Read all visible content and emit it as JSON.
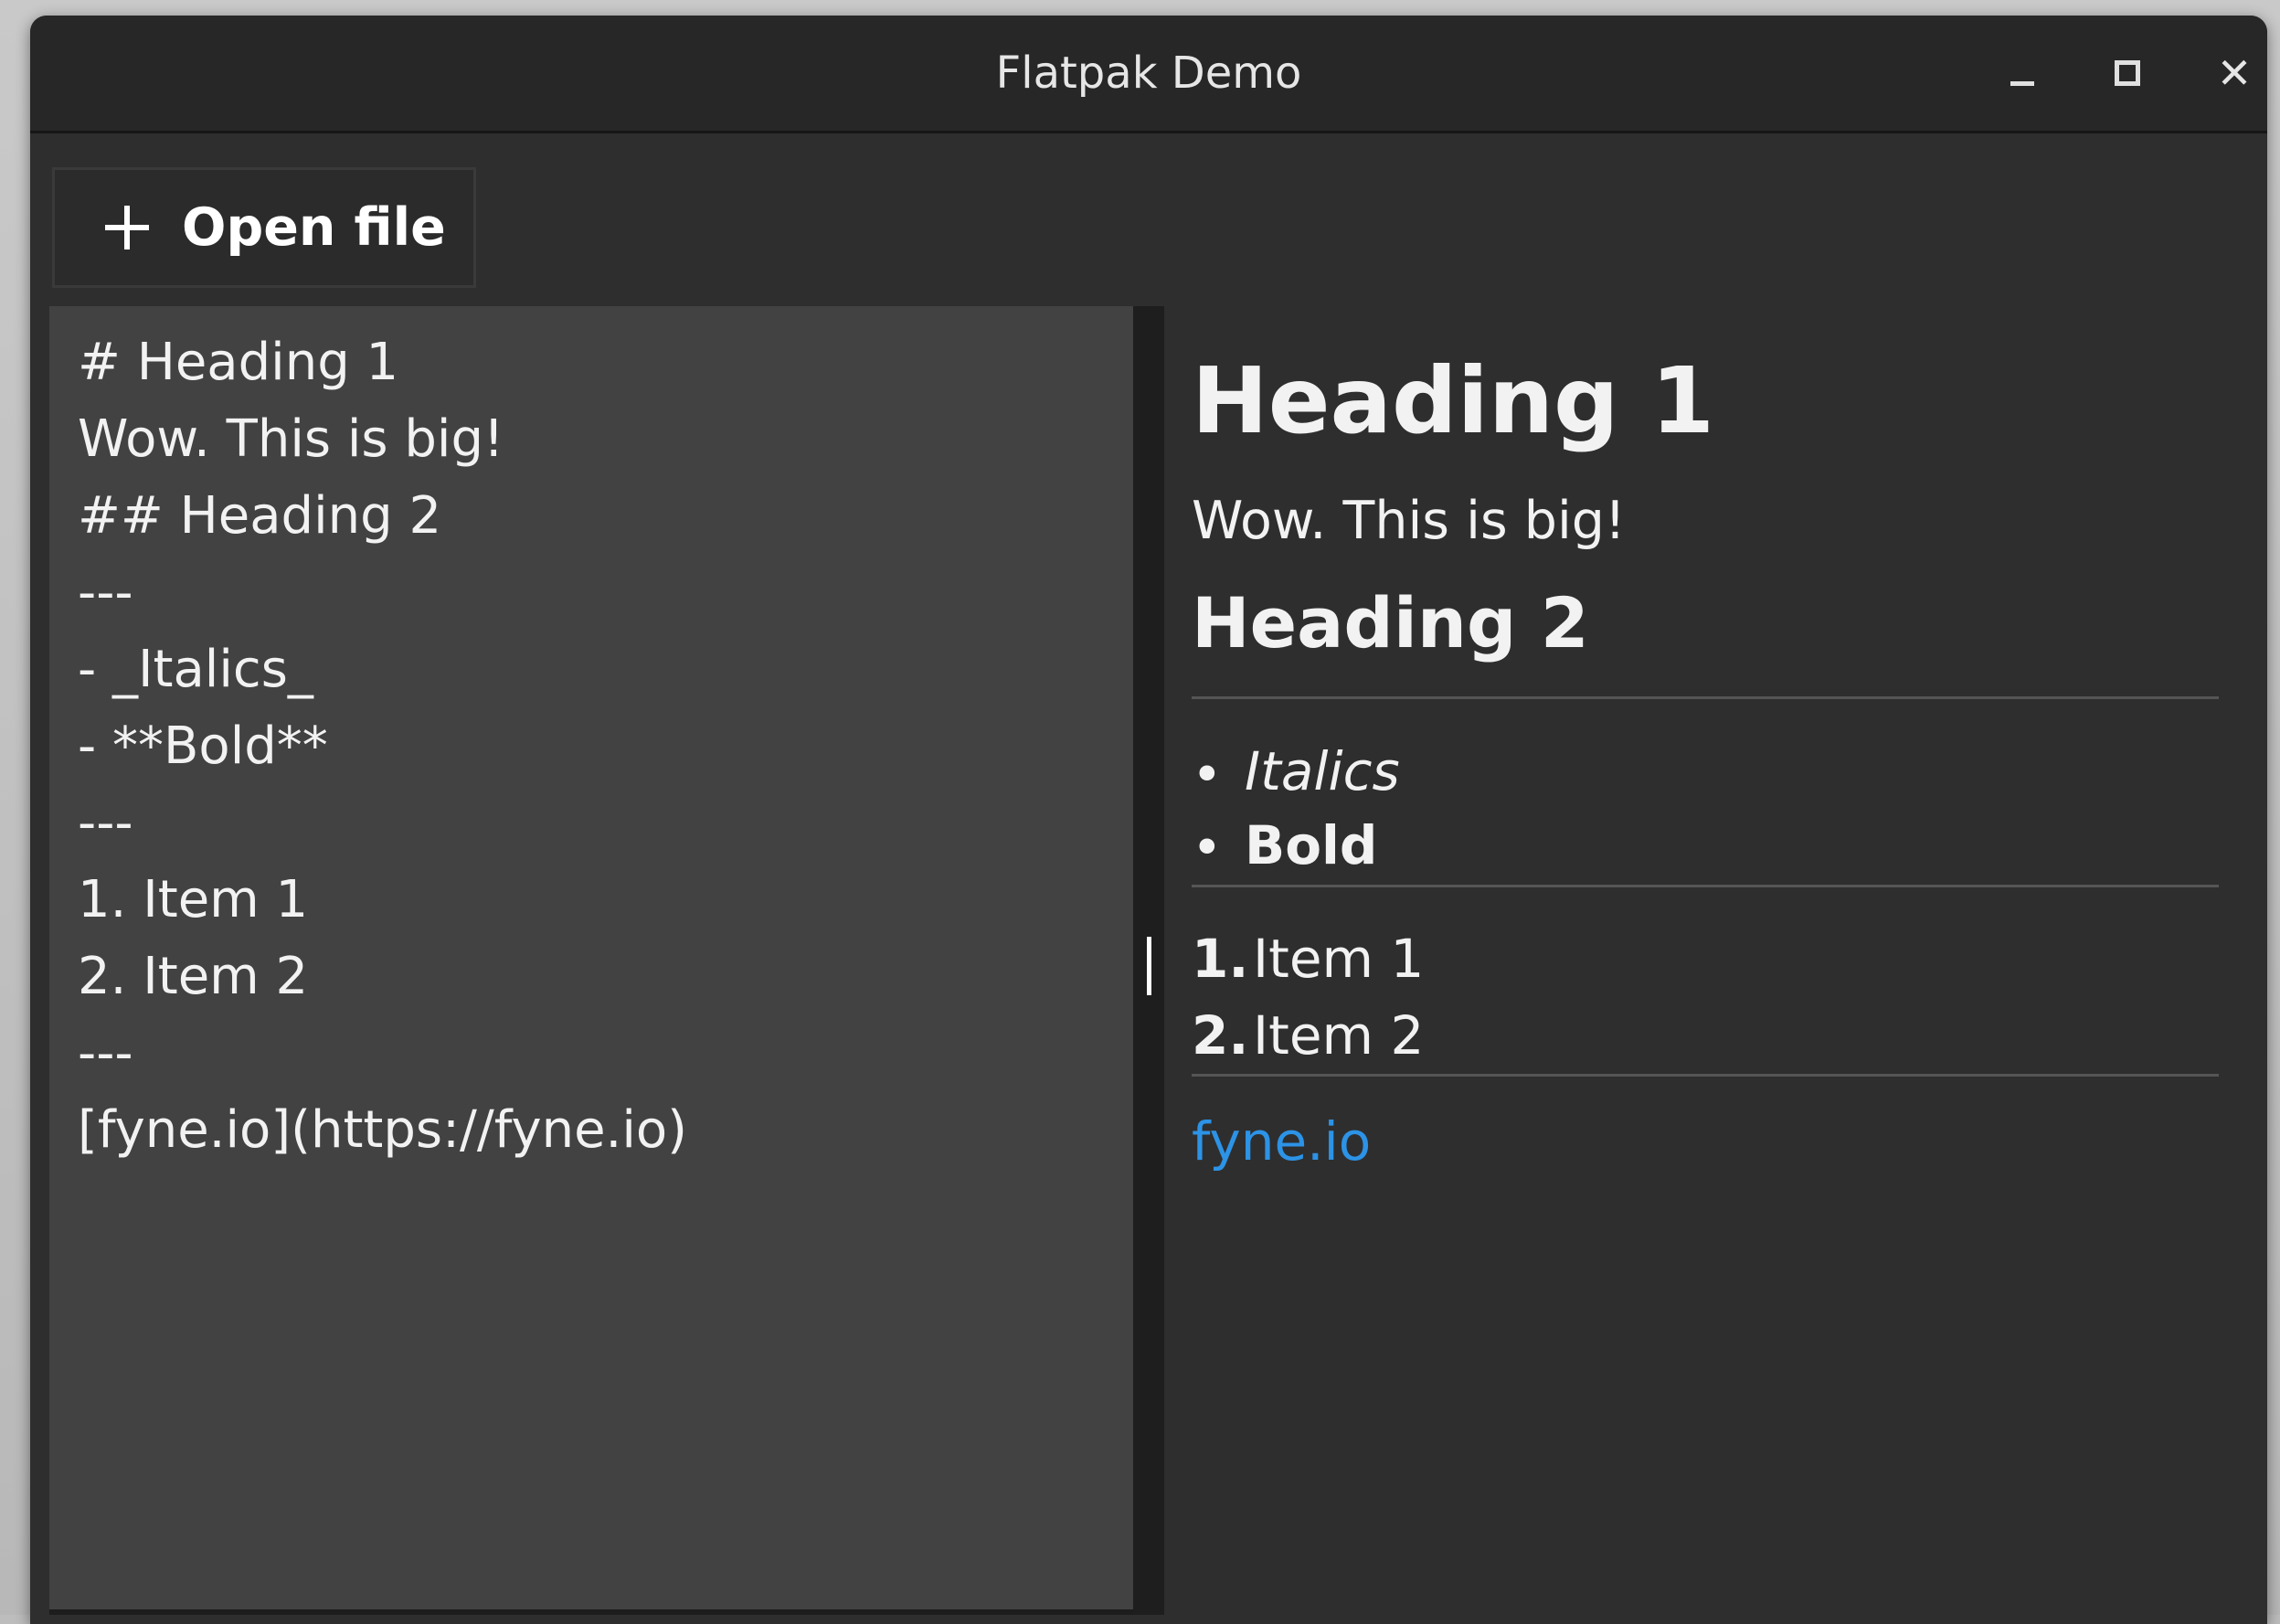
{
  "window": {
    "title": "Flatpak Demo"
  },
  "toolbar": {
    "open_file_label": "Open file"
  },
  "editor": {
    "lines": [
      "# Heading 1",
      "Wow. This is big!",
      "## Heading 2",
      "---",
      "- _Italics_",
      "- **Bold**",
      "---",
      "1. Item 1",
      "2. Item 2",
      "---",
      "[fyne.io](https://fyne.io)"
    ]
  },
  "preview": {
    "heading1": "Heading 1",
    "paragraph": "Wow. This is big!",
    "heading2": "Heading 2",
    "bullets": [
      "Italics",
      "Bold"
    ],
    "bullet_symbol": "•",
    "ordered": [
      {
        "num": "1.",
        "text": "Item 1"
      },
      {
        "num": "2.",
        "text": "Item 2"
      }
    ],
    "link_text": "fyne.io"
  },
  "colors": {
    "link": "#2c93e6",
    "editor_bg": "#424242",
    "window_bg": "#2e2e2e"
  }
}
